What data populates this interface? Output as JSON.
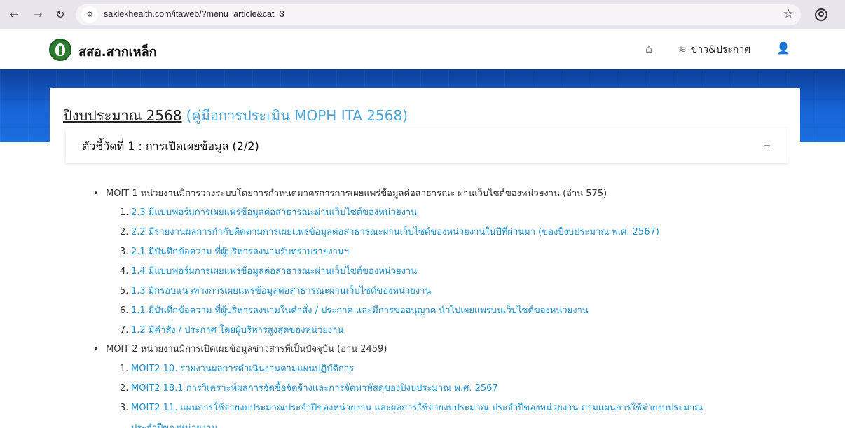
{
  "browser": {
    "url": "saklekhealth.com/itaweb/?menu=article&cat=3"
  },
  "site": {
    "title": "สสอ.สากเหล็ก",
    "nav_news": "ข่าว&ประกาศ"
  },
  "page": {
    "heading_main": "ปีงบประมาณ 2568",
    "heading_link": "(คู่มือการประเมิน MOPH ITA 2568)"
  },
  "accordion": {
    "title": "ตัวชี้วัดที่ 1 : การเปิดเผยข้อมูล (2/2)",
    "collapse_symbol": "–"
  },
  "moit1": {
    "label": "MOIT 1 หน่วยงานมีการวางระบบโดยการกำหนดมาตรการการเผยแพร่ข้อมูลต่อสาธารณะ ผ่านเว็บไซต์ของหน่วยงาน (อ่าน 575)",
    "items": [
      {
        "num": "1.",
        "text": "2.3 มีแบบฟอร์มการเผยแพร่ข้อมูลต่อสาธารณะผ่านเว็บไซต์ของหน่วยงาน"
      },
      {
        "num": "2.",
        "text": "2.2 มีรายงานผลการกำกับติดตามการเผยแพร่ข้อมูลต่อสาธารณะผ่านเว็บไซต์ของหน่วยงานในปีที่ผ่านมา (ของปีงบประมาณ พ.ศ. 2567)"
      },
      {
        "num": "3.",
        "text": "2.1 มีบันทึกข้อความ ที่ผู้บริหารลงนามรับทราบรายงานฯ"
      },
      {
        "num": "4.",
        "text": "1.4 มีแบบฟอร์มการเผยแพร่ข้อมูลต่อสาธารณะผ่านเว็บไซต์ของหน่วยงาน"
      },
      {
        "num": "5.",
        "text": "1.3 มีกรอบแนวทางการเผยแพร่ข้อมูลต่อสาธารณะผ่านเว็บไซต์ของหน่วยงาน"
      },
      {
        "num": "6.",
        "text": "1.1 มีบันทึกข้อความ ที่ผู้บริหารลงนามในคำสั่ง / ประกาศ และมีการขออนุญาต นำไปเผยแพร่บนเว็บไซต์ของหน่วยงาน"
      },
      {
        "num": "7.",
        "text": "1.2 มีคำสั่ง / ประกาศ โดยผู้บริหารสูงสุดของหน่วยงาน"
      }
    ]
  },
  "moit2": {
    "label": "MOIT 2 หน่วยงานมีการเปิดเผยข้อมูลข่าวสารที่เป็นปัจจุบัน (อ่าน 2459)",
    "items": [
      {
        "num": "1.",
        "text": "MOIT2 10. รายงานผลการดำเนินงานตามแผนปฏิบัติการ"
      },
      {
        "num": "2.",
        "text": "MOIT2 18.1 การวิเคราะห์ผลการจัดซื้อจัดจ้างและการจัดหาพัสดุของปีงบประมาณ พ.ศ. 2567"
      },
      {
        "num": "3.",
        "text": "MOIT2 11. แผนการใช้จ่ายงบประมาณประจำปีของหน่วยงาน และผลการใช้จ่ายงบประมาณ ประจำปีของหน่วยงาน ตามแผนการใช้จ่ายงบประมาณ",
        "text_line2": "ประจำปีของหน่วยงาน"
      }
    ]
  }
}
